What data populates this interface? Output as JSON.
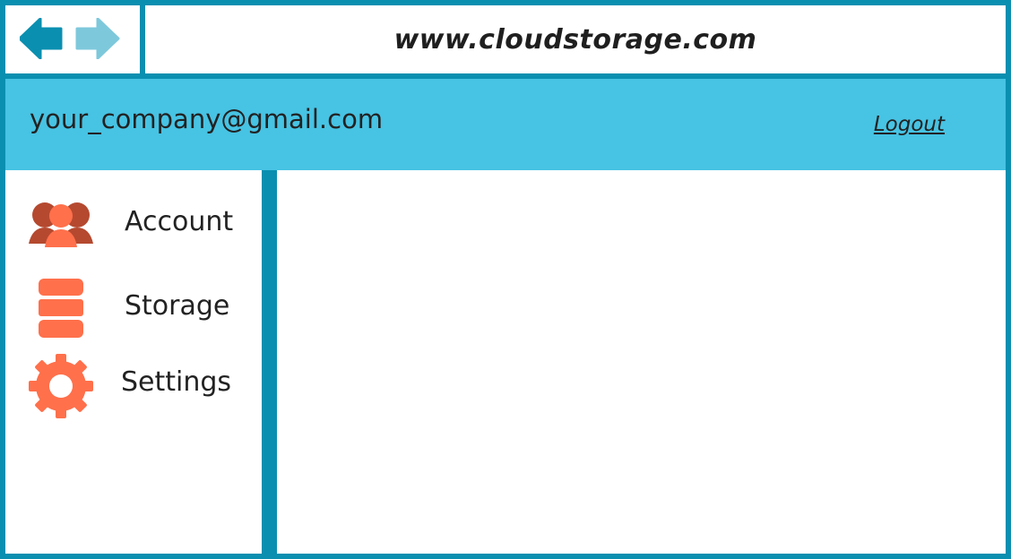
{
  "browser": {
    "url": "www.cloudstorage.com",
    "back_icon": "arrow-left-icon",
    "forward_icon": "arrow-right-icon"
  },
  "header": {
    "account_email": "your_company@gmail.com",
    "logout_label": "Logout"
  },
  "sidebar": {
    "items": [
      {
        "label": "Account",
        "icon": "users-icon"
      },
      {
        "label": "Storage",
        "icon": "database-icon"
      },
      {
        "label": "Settings",
        "icon": "gear-icon"
      }
    ]
  },
  "colors": {
    "frame": "#0a8fb0",
    "header_band": "#47c3e3",
    "icon_primary": "#ff704b",
    "icon_dark": "#b5492f",
    "arrow_back": "#0a8fb0",
    "arrow_forward": "#7ec8dc"
  }
}
